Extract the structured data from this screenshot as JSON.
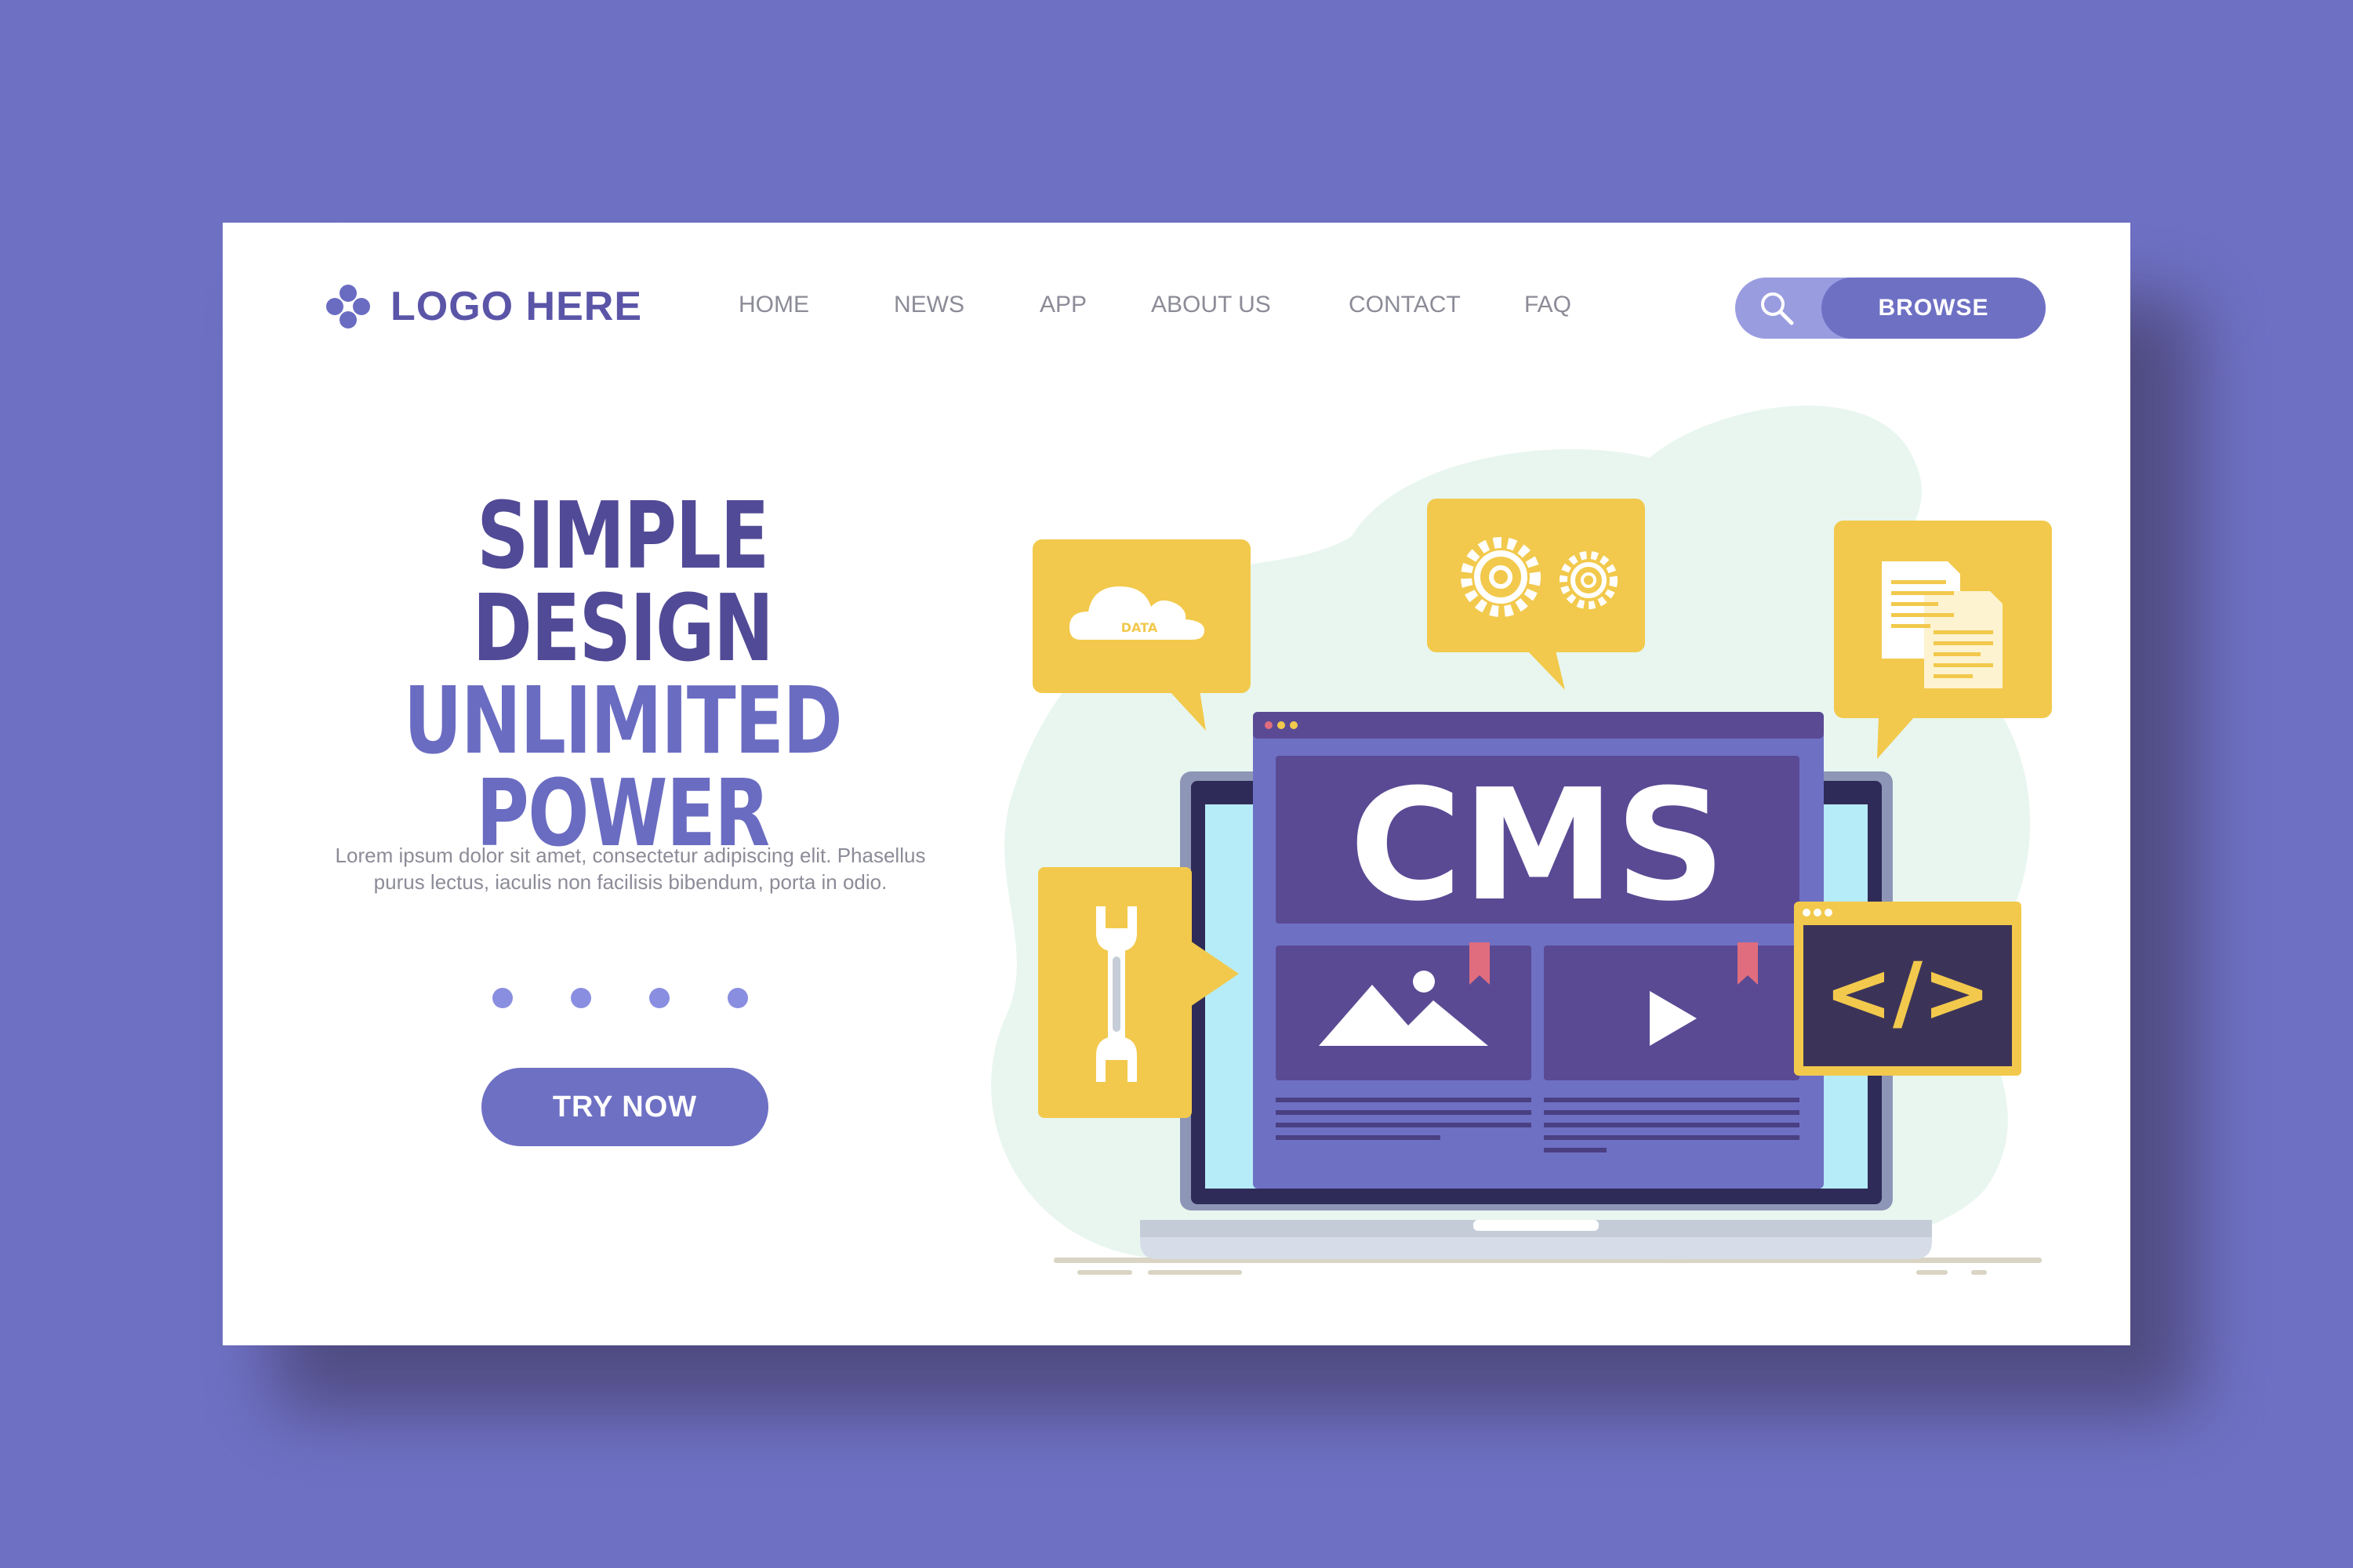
{
  "header": {
    "logo_text": "LOGO HERE",
    "nav": [
      "HOME",
      "NEWS",
      "APP",
      "ABOUT US",
      "CONTACT",
      "FAQ"
    ],
    "browse_label": "BROWSE"
  },
  "hero": {
    "headline_line1": "SIMPLE DESIGN",
    "headline_line2": "UNLIMITED POWER",
    "body": "Lorem ipsum dolor sit amet, consectetur adipiscing elit. Phasellus purus lectus, iaculis non facilisis bibendum, porta in odio.",
    "cta_label": "TRY NOW",
    "pager_dots": 4
  },
  "illustration": {
    "screen_title": "CMS",
    "cloud_label": "DATA",
    "code_label": "</>",
    "icons": [
      "cloud-icon",
      "gears-icon",
      "documents-icon",
      "wrench-icon",
      "code-window-icon",
      "image-icon",
      "play-icon"
    ]
  },
  "colors": {
    "background": "#6e70c4",
    "card": "#ffffff",
    "primary": "#6e70c4",
    "headline_dark": "#514a96",
    "accent_yellow": "#f2c94c",
    "screen_purple": "#5a4a94",
    "blob_green": "#e8f6ef"
  }
}
